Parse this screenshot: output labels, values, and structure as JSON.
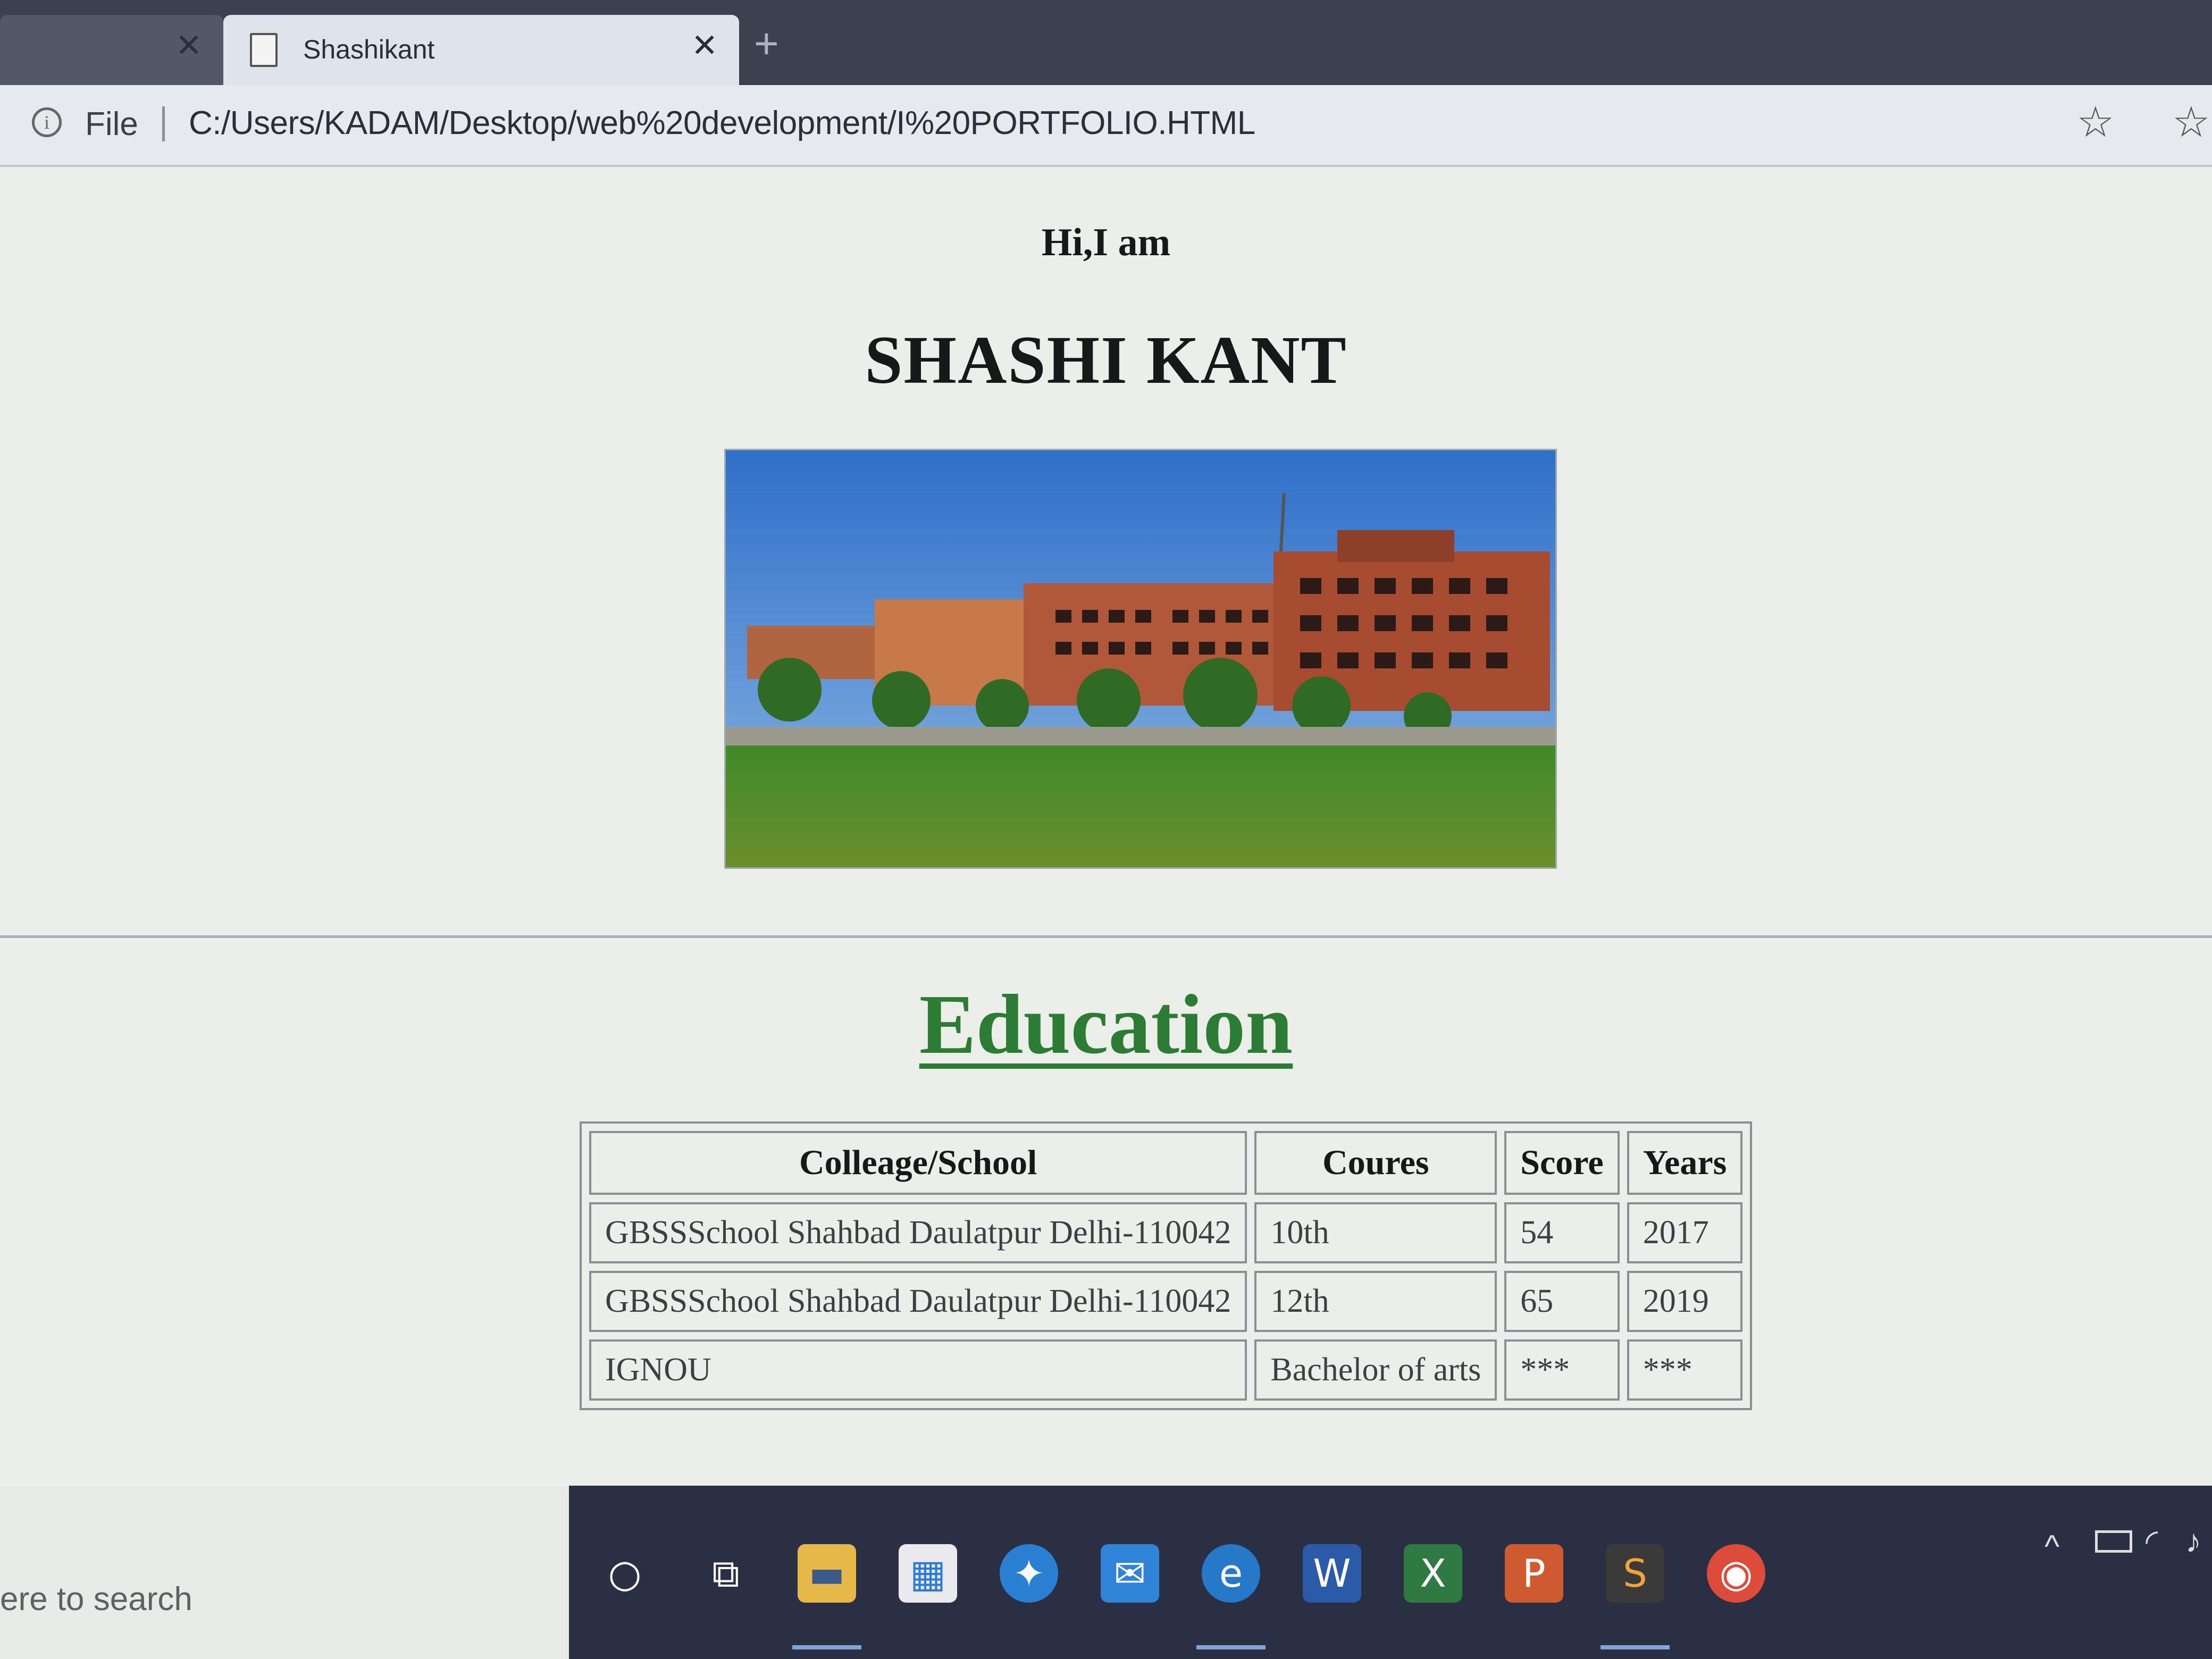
{
  "browser": {
    "tabs": [
      {
        "title": ""
      },
      {
        "title": "Shashikant"
      }
    ],
    "address": {
      "scheme_label": "File",
      "url": "C:/Users/KADAM/Desktop/web%20development/I%20PORTFOLIO.HTML"
    }
  },
  "page": {
    "greeting": "Hi,I am",
    "name": "SHASHI KANT",
    "section_heading": "Education",
    "section_heading_color": "#2c7c35",
    "table": {
      "headers": [
        "Colleage/School",
        "Coures",
        "Score",
        "Years"
      ],
      "rows": [
        [
          "GBSSSchool Shahbad Daulatpur Delhi-110042",
          "10th",
          "54",
          "2017"
        ],
        [
          "GBSSSchool Shahbad Daulatpur Delhi-110042",
          "12th",
          "65",
          "2019"
        ],
        [
          "IGNOU",
          "Bachelor of arts",
          "***",
          "***"
        ]
      ]
    }
  },
  "taskbar": {
    "search_placeholder": "ere to search",
    "icons": [
      "cortana-icon",
      "task-view-icon",
      "file-explorer-icon",
      "store-icon",
      "safari-icon",
      "mail-icon",
      "edge-icon",
      "word-icon",
      "excel-icon",
      "powerpoint-icon",
      "sublime-icon",
      "chrome-icon"
    ]
  }
}
